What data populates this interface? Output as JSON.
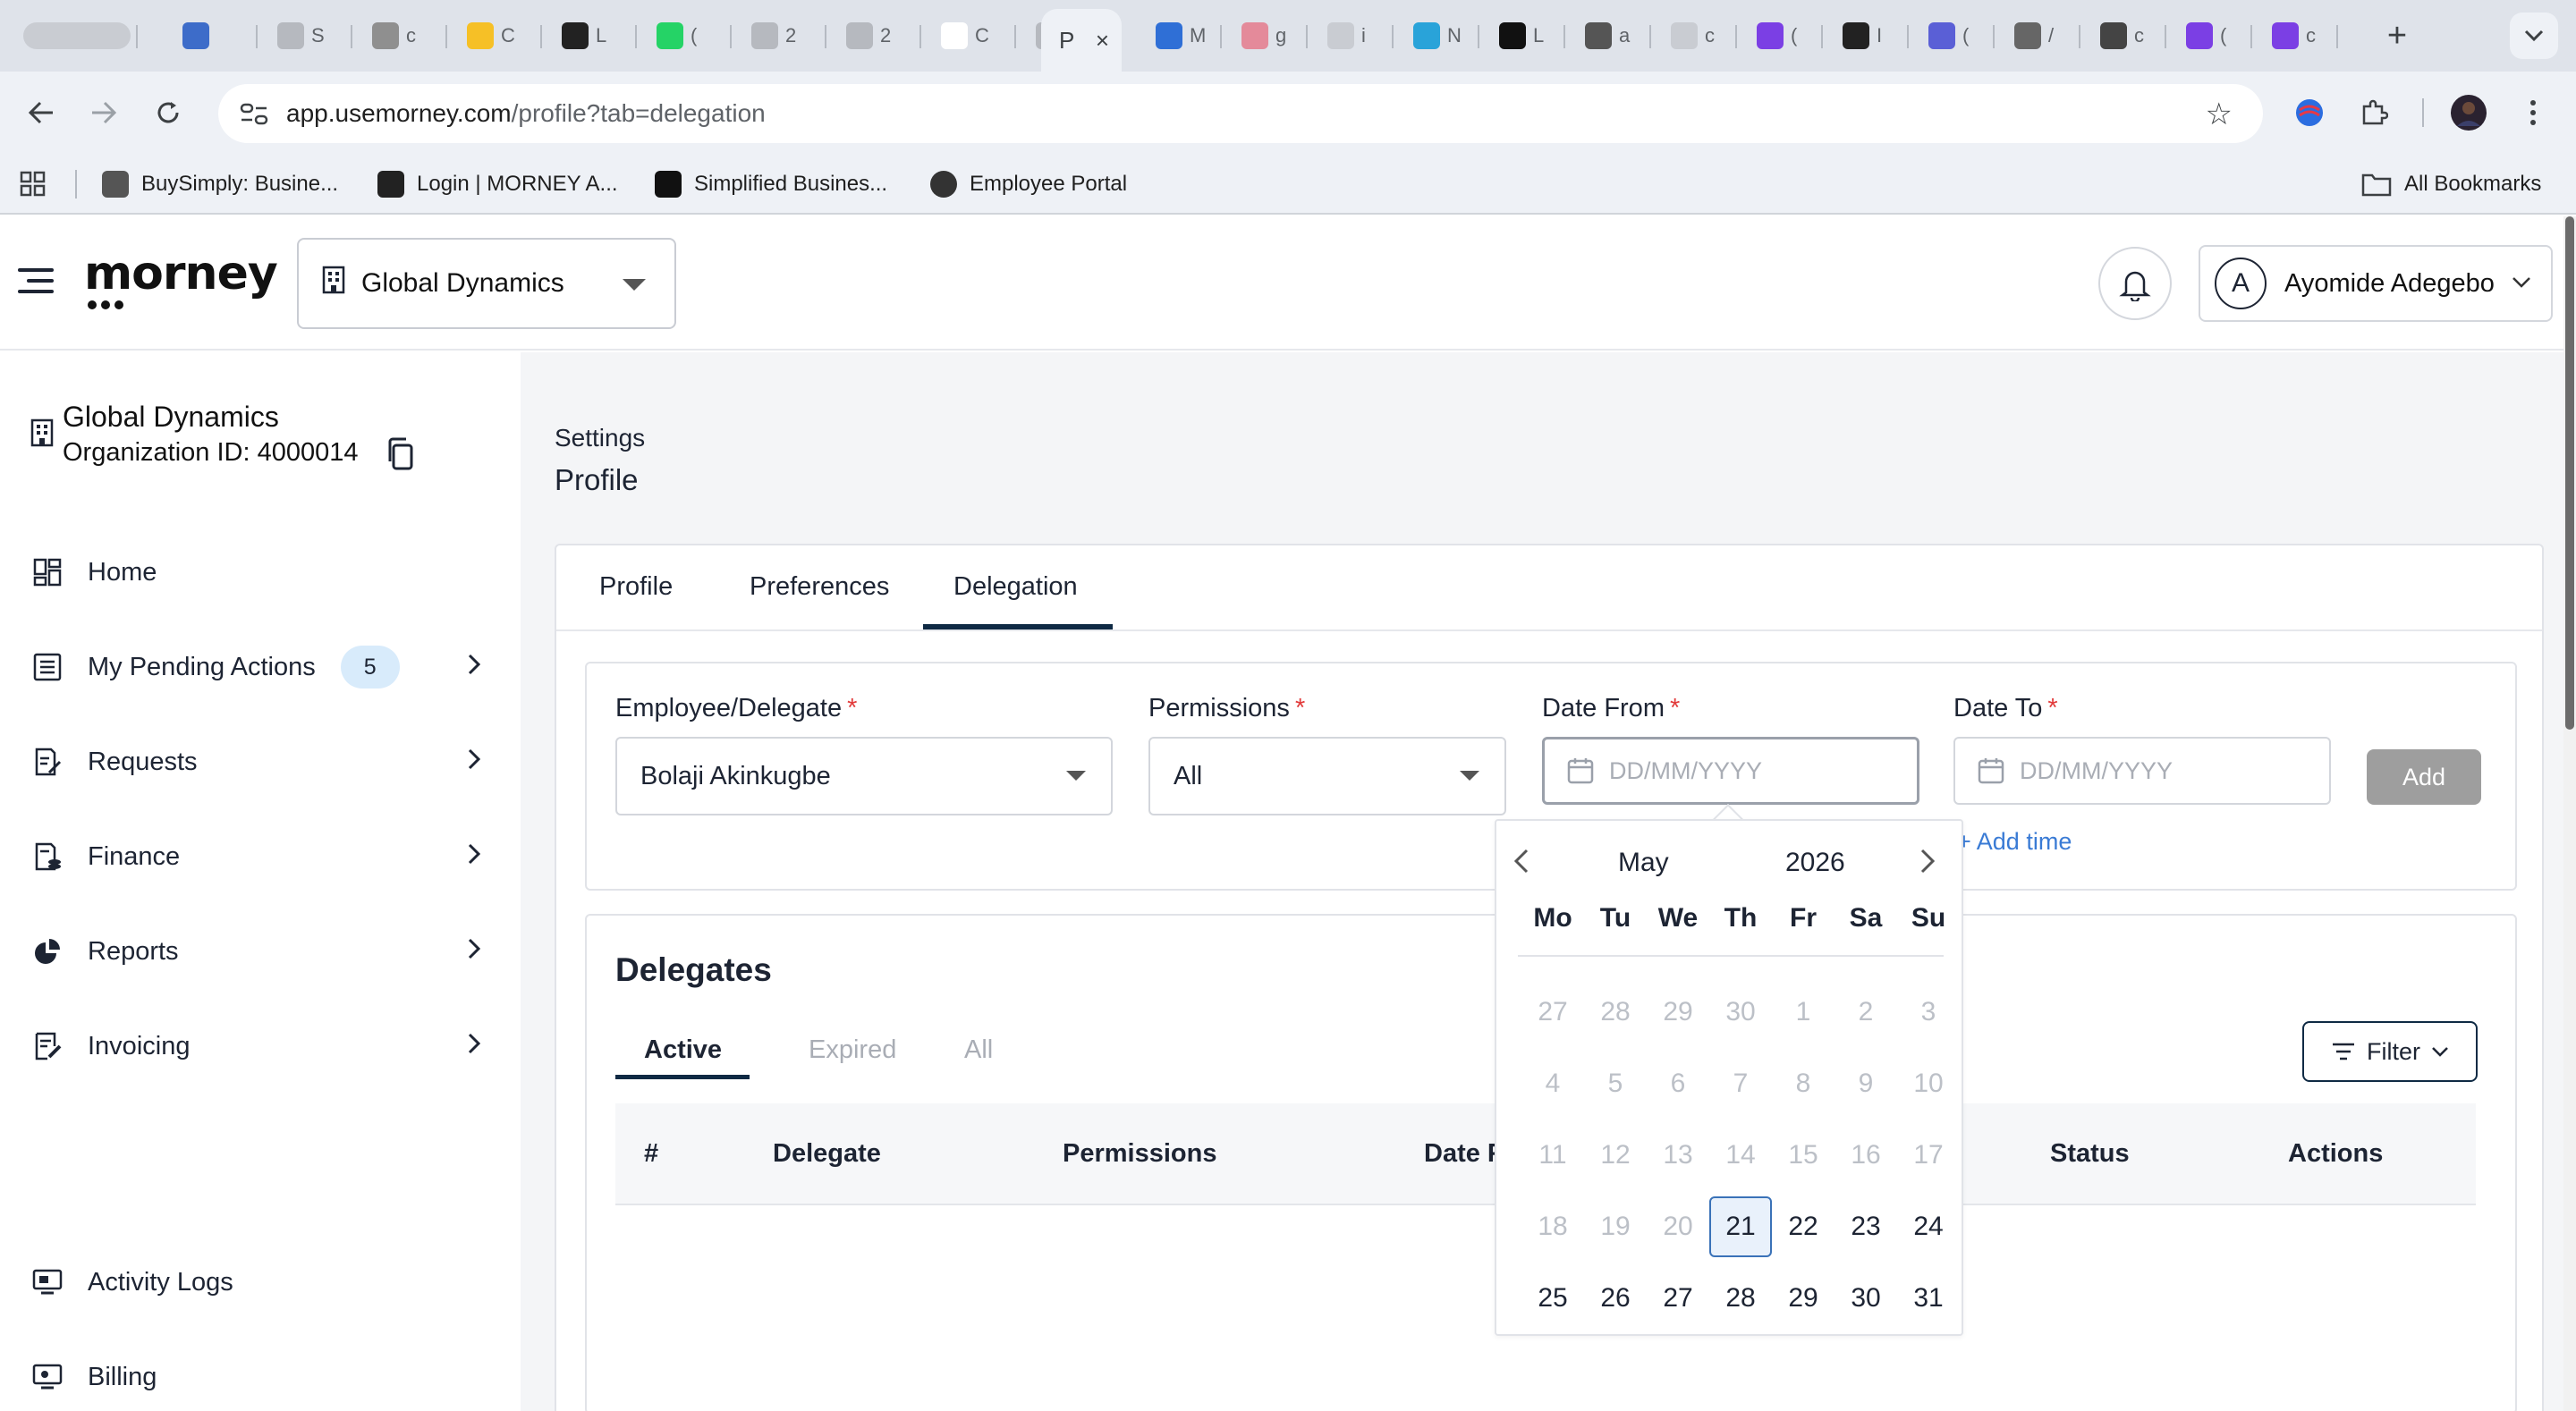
{
  "browser": {
    "tabs": [
      {
        "letter": "",
        "color": "#c9ccd2"
      },
      {
        "letter": "",
        "color": "#3d6cc9"
      },
      {
        "letter": "S",
        "color": "#b6b9bf"
      },
      {
        "letter": "c",
        "color": "#8f8f8f"
      },
      {
        "letter": "C",
        "color": "#f6c026"
      },
      {
        "letter": "L",
        "color": "#222222"
      },
      {
        "letter": "(",
        "color": "#25d366"
      },
      {
        "letter": "2",
        "color": "#b6b9bf"
      },
      {
        "letter": "2",
        "color": "#b6b9bf"
      },
      {
        "letter": "C",
        "color": "#ffffff"
      },
      {
        "letter": "M",
        "color": "#b6b9bf"
      }
    ],
    "active_tab": {
      "letter": "P",
      "close": "×"
    },
    "tabs_right": [
      {
        "letter": "M",
        "color": "#2f6fd6"
      },
      {
        "letter": "g",
        "color": "#e48a9a"
      },
      {
        "letter": "i",
        "color": "#c9ccd2"
      },
      {
        "letter": "N",
        "color": "#29a3d9"
      },
      {
        "letter": "L",
        "color": "#111111"
      },
      {
        "letter": "a",
        "color": "#555555"
      },
      {
        "letter": "c",
        "color": "#c9ccd2"
      },
      {
        "letter": "(",
        "color": "#7b3fe4"
      },
      {
        "letter": "I",
        "color": "#222222"
      },
      {
        "letter": "(",
        "color": "#5a5fd6"
      },
      {
        "letter": "/",
        "color": "#666666"
      },
      {
        "letter": "c",
        "color": "#444444"
      },
      {
        "letter": "(",
        "color": "#7b3fe4"
      },
      {
        "letter": "c",
        "color": "#7b3fe4"
      }
    ],
    "new_tab": "+",
    "url_host": "app.usemorney.com",
    "url_path": "/profile?tab=delegation",
    "bookmarks": [
      {
        "label": "BuySimply: Busine...",
        "color": "#444444"
      },
      {
        "label": "Login | MORNEY A...",
        "color": "#222222"
      },
      {
        "label": "Simplified Busines...",
        "color": "#111111"
      },
      {
        "label": "Employee Portal",
        "color": "#333333"
      }
    ],
    "all_bookmarks": "All Bookmarks"
  },
  "header": {
    "logo": "morney",
    "org": "Global Dynamics",
    "user_initial": "A",
    "user_name": "Ayomide Adegebo"
  },
  "sidebar": {
    "org_name": "Global Dynamics",
    "org_id": "Organization ID: 4000014",
    "items": [
      {
        "label": "Home",
        "icon": "grid-icon"
      },
      {
        "label": "My Pending Actions",
        "icon": "list-icon",
        "badge": "5"
      },
      {
        "label": "Requests",
        "icon": "edit-doc-icon"
      },
      {
        "label": "Finance",
        "icon": "finance-doc-icon"
      },
      {
        "label": "Reports",
        "icon": "pie-chart-icon"
      },
      {
        "label": "Invoicing",
        "icon": "invoice-icon"
      }
    ],
    "bottom_items": [
      {
        "label": "Activity Logs",
        "icon": "monitor-icon"
      },
      {
        "label": "Billing",
        "icon": "billing-icon"
      }
    ]
  },
  "main": {
    "breadcrumb": "Settings",
    "title": "Profile",
    "tabs": [
      "Profile",
      "Preferences",
      "Delegation"
    ],
    "active_tab": "Delegation",
    "form": {
      "employee_label": "Employee/Delegate",
      "employee_value": "Bolaji Akinkugbe",
      "permissions_label": "Permissions",
      "permissions_value": "All",
      "date_from_label": "Date From",
      "date_from_placeholder": "DD/MM/YYYY",
      "date_to_label": "Date To",
      "date_to_placeholder": "DD/MM/YYYY",
      "required_mark": "*",
      "add_label": "Add",
      "add_time_label": "+ Add time"
    },
    "delegates": {
      "title": "Delegates",
      "tabs": [
        "Active",
        "Expired",
        "All"
      ],
      "filter_label": "Filter",
      "columns": [
        "#",
        "Delegate",
        "Permissions",
        "Date F",
        "Status",
        "Actions"
      ]
    }
  },
  "datepicker": {
    "month": "May",
    "year": "2026",
    "weekdays": [
      "Mo",
      "Tu",
      "We",
      "Th",
      "Fr",
      "Sa",
      "Su"
    ],
    "weeks": [
      [
        "27",
        "28",
        "29",
        "30",
        "1",
        "2",
        "3"
      ],
      [
        "4",
        "5",
        "6",
        "7",
        "8",
        "9",
        "10"
      ],
      [
        "11",
        "12",
        "13",
        "14",
        "15",
        "16",
        "17"
      ],
      [
        "18",
        "19",
        "20",
        "21",
        "22",
        "23",
        "24"
      ],
      [
        "25",
        "26",
        "27",
        "28",
        "29",
        "30",
        "31"
      ]
    ],
    "today": "21",
    "first_selectable": "21"
  },
  "colors": {
    "accent": "#0f2a44",
    "link": "#3a7bd5",
    "required": "#e23b3b",
    "badge_bg": "#d8ebfb",
    "today_border": "#3a72b8"
  }
}
